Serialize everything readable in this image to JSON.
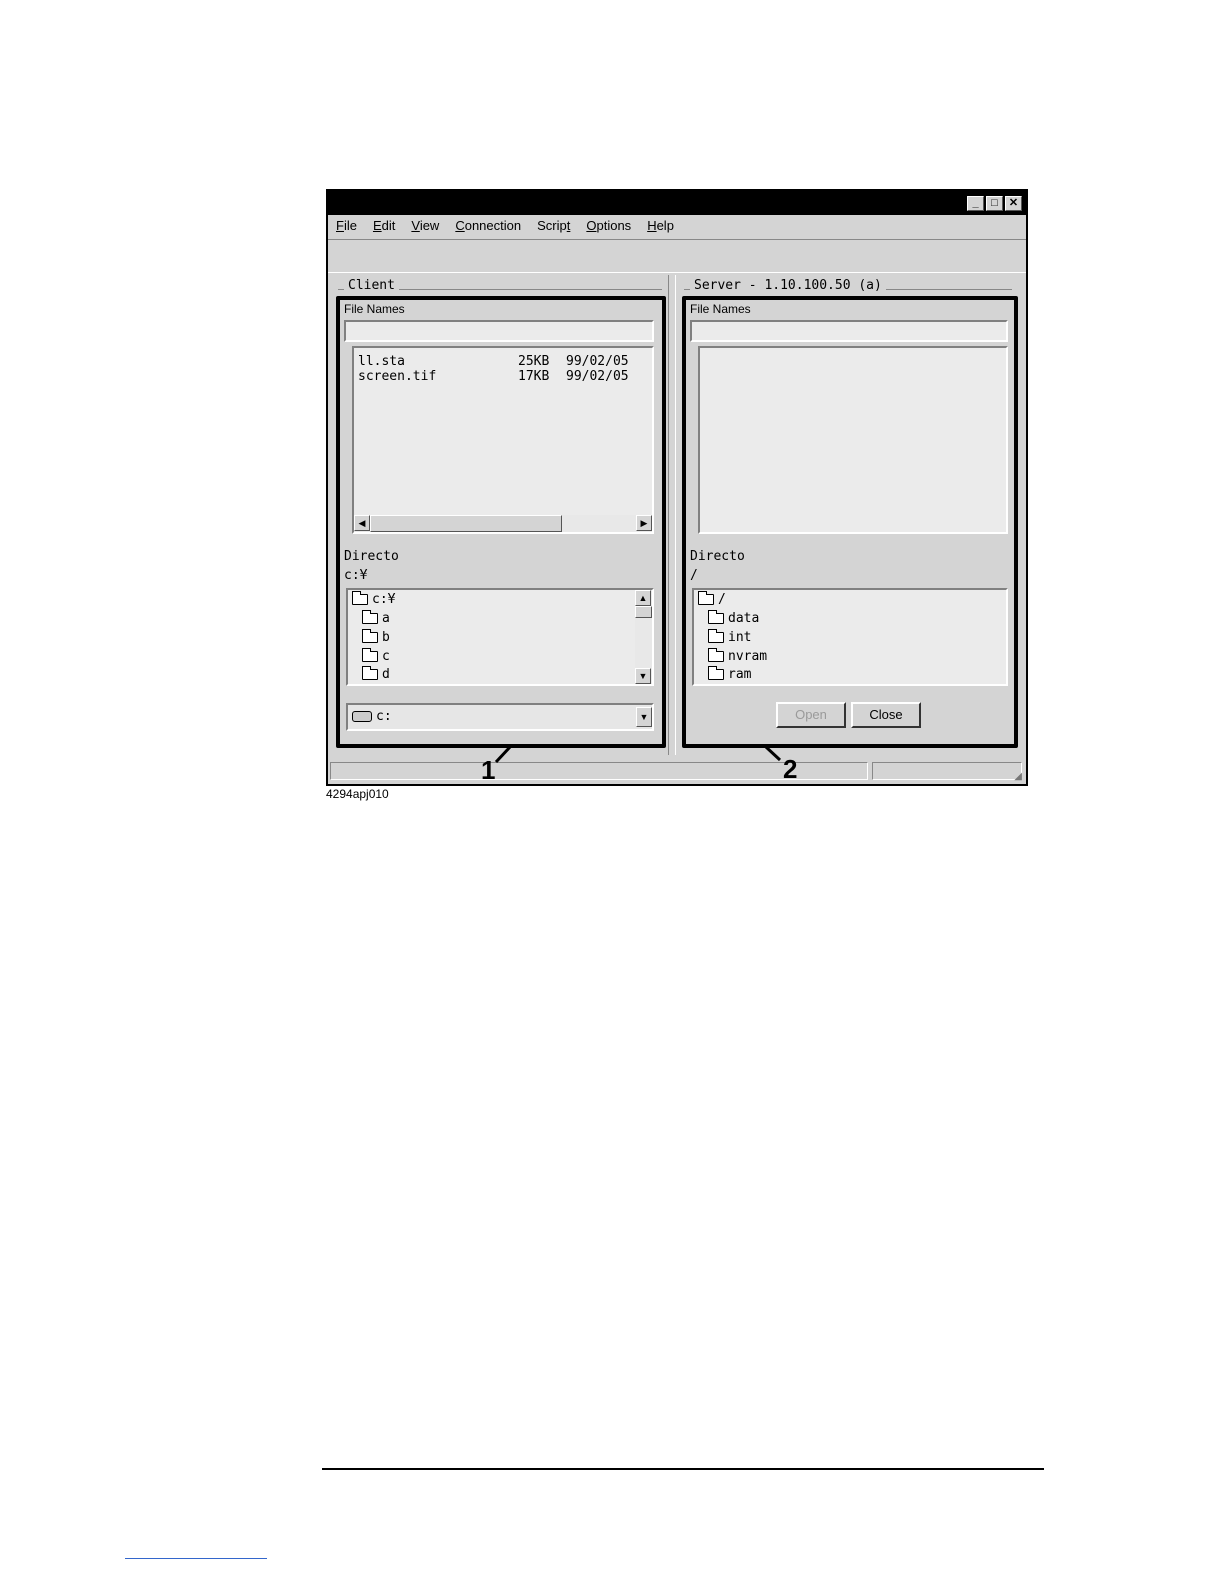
{
  "menu": [
    {
      "pre": "",
      "u": "F",
      "post": "ile"
    },
    {
      "pre": "",
      "u": "E",
      "post": "dit"
    },
    {
      "pre": "",
      "u": "V",
      "post": "iew"
    },
    {
      "pre": "",
      "u": "C",
      "post": "onnection"
    },
    {
      "pre": "Scrip",
      "u": "t",
      "post": ""
    },
    {
      "pre": "",
      "u": "O",
      "post": "ptions"
    },
    {
      "pre": "",
      "u": "H",
      "post": "elp"
    }
  ],
  "client": {
    "group_label": "Client",
    "file_names_label": "File Names",
    "files": [
      {
        "name": "ll.sta",
        "size": "25KB",
        "date": "99/02/05"
      },
      {
        "name": "screen.tif",
        "size": "17KB",
        "date": "99/02/05"
      }
    ],
    "directory_label": "Directo",
    "directory_value": "c:¥",
    "tree": [
      "c:¥",
      "a",
      "b",
      "c",
      "d"
    ],
    "drive": "c:"
  },
  "server": {
    "group_label": "Server - 1.10.100.50 (a)",
    "file_names_label": "File Names",
    "directory_label": "Directo",
    "directory_value": "/",
    "tree": [
      "/",
      "data",
      "int",
      "nvram",
      "ram"
    ],
    "open_label": "Open",
    "close_label": "Close"
  },
  "callouts": {
    "one": "1",
    "two": "2"
  },
  "caption": "4294apj010"
}
